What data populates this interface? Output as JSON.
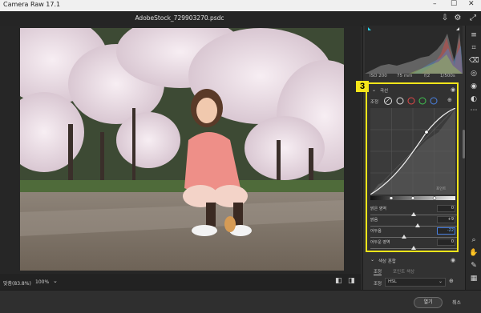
{
  "app": {
    "title": "Camera Raw 17.1"
  },
  "file": {
    "name": "AdobeStock_729903270.psdc"
  },
  "exif": {
    "iso": "ISO 200",
    "focal": "75 mm",
    "aperture": "f/2",
    "shutter": "1/500s"
  },
  "curve": {
    "title": "곡선",
    "adjust_label": "조정",
    "point_label": "포인트",
    "callout": "3",
    "sliders": [
      {
        "name": "밝은 영역",
        "value": "0",
        "level": 0.5
      },
      {
        "name": "밝음",
        "value": "+9",
        "level": 0.55
      },
      {
        "name": "어두움",
        "value": "-22",
        "level": 0.39
      },
      {
        "name": "어두운 영역",
        "value": "0",
        "level": 0.5
      }
    ]
  },
  "color_mixer": {
    "title": "색상 혼합",
    "tab1": "조정",
    "tab2": "포인트 색상",
    "mix_label": "조정",
    "mix_value": "HSL"
  },
  "zoom": {
    "fit": "맞춤(83.8%)",
    "value": "100%"
  },
  "footer": {
    "open": "열기",
    "cancel": "취소"
  },
  "colors": {
    "highlight": "#f5e51a",
    "accent": "#4aa3ff"
  }
}
